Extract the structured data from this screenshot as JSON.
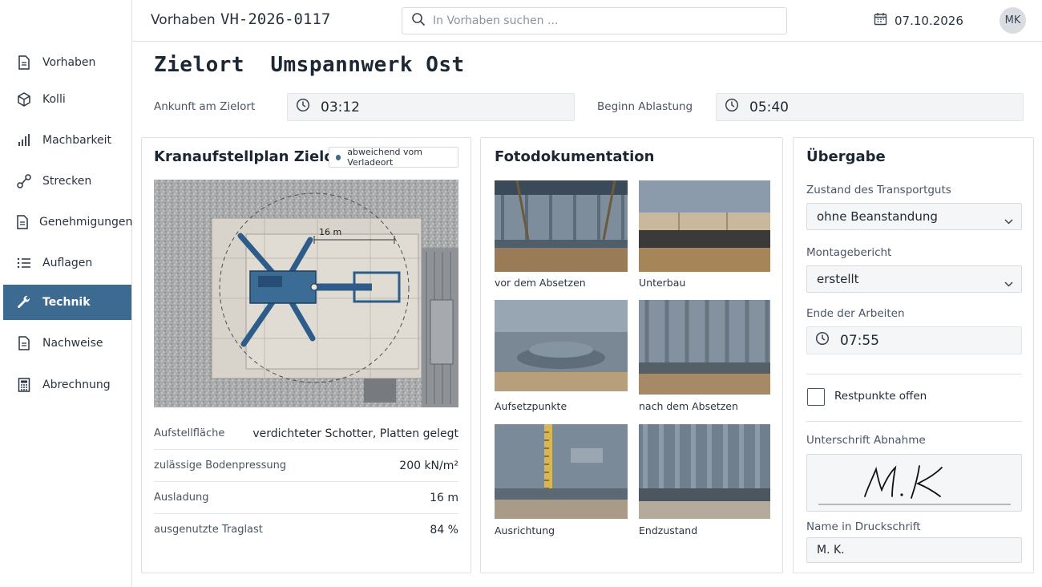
{
  "header": {
    "breadcrumb": "Vorhaben",
    "project_id": "VH-2026-0117",
    "search_placeholder": "In Vorhaben suchen ...",
    "date": "07.10.2026",
    "avatar_initials": "MK"
  },
  "sidebar": {
    "items": [
      {
        "label": "Vorhaben",
        "icon": "document-icon",
        "active": false
      },
      {
        "label": "Kolli",
        "icon": "package-icon",
        "active": false
      },
      {
        "label": "Machbarkeit",
        "icon": "bar-chart-icon",
        "active": false
      },
      {
        "label": "Strecken",
        "icon": "route-icon",
        "active": false
      },
      {
        "label": "Genehmigungen",
        "icon": "document-icon",
        "active": false
      },
      {
        "label": "Auflagen",
        "icon": "list-icon",
        "active": false
      },
      {
        "label": "Technik",
        "icon": "wrench-icon",
        "active": true
      },
      {
        "label": "Nachweise",
        "icon": "document-icon",
        "active": false
      },
      {
        "label": "Abrechnung",
        "icon": "calculator-icon",
        "active": false
      }
    ]
  },
  "page": {
    "title": "Zielort  Umspannwerk Ost",
    "arrival_label": "Ankunft am Zielort",
    "arrival_time": "03:12",
    "unloading_label": "Beginn Ablastung",
    "unloading_time": "05:40"
  },
  "crane_plan": {
    "title": "Kranaufstellplan Zielort",
    "badge": "abweichend vom Verladeort",
    "dimension_label": "16 m",
    "specs": [
      {
        "label": "Aufstellfläche",
        "value": "verdichteter Schotter, Platten gelegt"
      },
      {
        "label": "zulässige Bodenpressung",
        "value": "200 kN/m²"
      },
      {
        "label": "Ausladung",
        "value": "16 m"
      },
      {
        "label": "ausgenutzte Traglast",
        "value": "84 %"
      }
    ]
  },
  "photos": {
    "title": "Fotodokumentation",
    "items": [
      {
        "caption": "vor dem Absetzen"
      },
      {
        "caption": "Unterbau"
      },
      {
        "caption": "Aufsetzpunkte"
      },
      {
        "caption": "nach dem Absetzen"
      },
      {
        "caption": "Ausrichtung"
      },
      {
        "caption": "Endzustand"
      }
    ]
  },
  "handover": {
    "title": "Übergabe",
    "condition_label": "Zustand des Transportguts",
    "condition_value": "ohne Beanstandung",
    "assembly_label": "Montagebericht",
    "assembly_value": "erstellt",
    "end_label": "Ende der Arbeiten",
    "end_time": "07:55",
    "remaining_label": "Restpunkte offen",
    "remaining_checked": false,
    "signature_label": "Unterschrift Abnahme",
    "signature_text": "M. K",
    "name_label": "Name in Druckschrift",
    "name_value": "M. K."
  },
  "colors": {
    "accent": "#3d6a91",
    "crane_blue": "#2d5c8a"
  }
}
